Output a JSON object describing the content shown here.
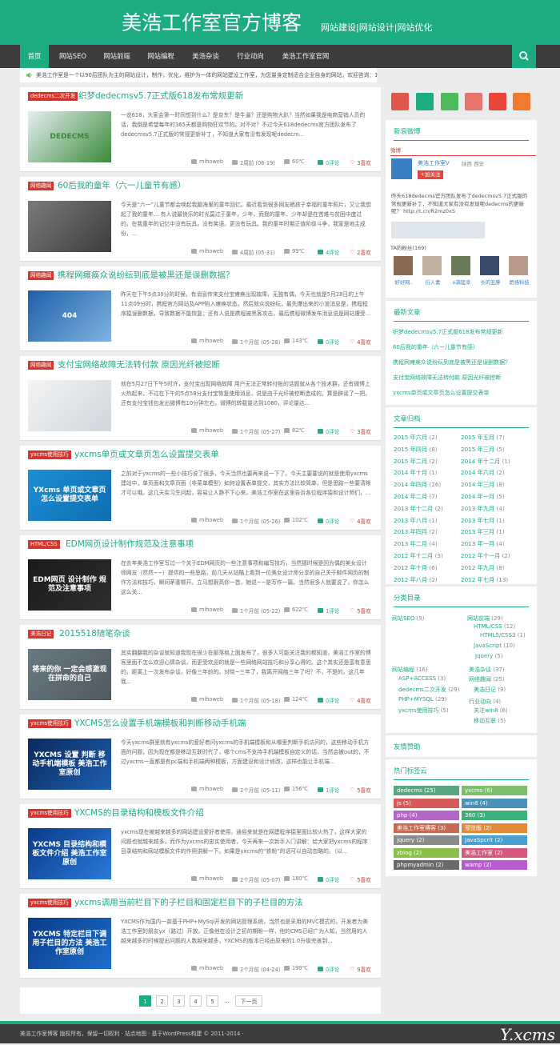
{
  "header": {
    "title": "美浩工作室官方博客",
    "subtitle": "网站建设|网站设计|网站优化"
  },
  "nav": {
    "items": [
      "首页",
      "网站SEO",
      "网站前端",
      "网站编程",
      "美浩杂谈",
      "行业动向",
      "美浩工作室官网"
    ],
    "active": 0
  },
  "notice": "美浩工作室是一个以90后团队为主的网站设计，制作，优化，维护为一体的网站建设工作室，为您量身定制适合企业自身的网站，欢迎咨询：15249241469",
  "posts": [
    {
      "category": "dedecms二次开发",
      "title": "织梦dedecmsv5.7正式版618发布常规更新",
      "excerpt": "一说618，大家会第一时间想到什么？是京东？是牛逼？还是购物大趴？当然如果我是电商营销人员的话，我倒是希望每年的365天都是购物狂欢节的。对不对？不过今天618dedecms官方团队发布了dedecmsv5.7正式版的常规更新补丁，不知道大家有没有发现呢dedecm...",
      "author": "mihoweb",
      "time": "2周前 (06-19)",
      "views": "60℃",
      "comments": "0评论",
      "likes": "3喜欢",
      "thumb_text": "DEDECMS"
    },
    {
      "category": "网络趣闻",
      "title": "60后我的童年（六一儿童节有感）",
      "excerpt": "今天是“六一”儿童节都会唤起我脑海里的童年回忆。最近看到很多网友晒孩子幸福的童年照片，又让我想起了我的童年… 有人说最快乐的时光莫过于童年，少年，而我的童年、少年却是在苦难与贫困中度过的。在我童年的记忆中没有玩具，没有笑语。更没有玩具。我的童年时期正值阶级斗争，我家是地主成份，...",
      "author": "mihoweb",
      "time": "4周前 (05-31)",
      "views": "99℃",
      "comments": "4评论",
      "likes": "2喜欢",
      "thumb_text": ""
    },
    {
      "category": "网络趣闻",
      "title": "携程网瘫痪众说纷纭到底是被黑还是误删数据？",
      "excerpt": "昨天在下午5点30分的时候，有消息传来支付宝瘫痪出现故障，无独有偶，今天也就是5月28日的上午11点09分时，携程官方网站及APP陷入瘫痪状态。然后就众说纷纭，最先爆出来的小道消息是，携程程序猿误删数据，导致数据不能恢复；还有人说是携程被黑客攻击，最后携程微博发布消息说是网站遭受...",
      "author": "mihoweb",
      "time": "1个月前 (05-28)",
      "views": "143℃",
      "comments": "0评论",
      "likes": "4喜欢",
      "thumb_text": "404"
    },
    {
      "category": "网络趣闻",
      "title": "支付宝网络故障无法转付款 原因光纤被挖断",
      "excerpt": "就在5月27日下午5时许，支付宝出现网络故障 用户无法正常转付账的话题就从各个技术群，还有微博上火热起来，不过在下午的5点58分支付宝恢复使用消息，说是由于光纤被挖断造成的。算是辟谣了一把。 还有支付宝钱包发出微博有10分钟左右，微博的转载量达到1080，评论量达...",
      "author": "mihoweb",
      "time": "1个月前 (05-27)",
      "views": "82℃",
      "comments": "0评论",
      "likes": "3喜欢",
      "thumb_text": ""
    },
    {
      "category": "yxcms使用技巧",
      "title": "yxcms单页或文章页怎么设置提交表单",
      "excerpt": "之前对于yxcms的一些小技巧说了很多，今天当然也要再来说一下了。今天主要要说的就是使用yxcms建站中，单页面和文章页面（非菜单模型）如何设置表单提交，其实方法比较简单，但是思路一些要清晰才可以哦。这几天实习生问起，容易让人静不下心来。美浩工作室在这里告诉各位程序猿和设计师们，...",
      "author": "mihoweb",
      "time": "1个月前 (05-26)",
      "views": "102℃",
      "comments": "0评论",
      "likes": "4喜欢",
      "thumb_text": "YXcms 单页或文章页 怎么设置提交表单"
    },
    {
      "category": "HTML/CSS",
      "title": "EDM网页设计制作规范及注意事项",
      "excerpt": "在去年美浩工作室写过一个关于EDM网页的一些注意事项和编写技巧，当然那时候是因为偶的美女设计师网友（然然~~）提供的一些思路，前几天从站酷上看到一位美女设计师分享的自己关于邮件网页的制作方法和技巧，瞬间茅塞顿开。立马想跟高你一首，她说~~是写作一篇。当然很多人就要说了，你怎么这么关...",
      "author": "mihoweb",
      "time": "1个月前 (05-22)",
      "views": "622℃",
      "comments": "1评论",
      "likes": "5喜欢",
      "thumb_text": "EDM网页 设计制作 规范及注意事项"
    },
    {
      "category": "美浩日记",
      "title": "2015518随笔杂谈",
      "excerpt": "其实翻翻我的杂谈就知道我现在很少在部落格上面发布了，很多人可能关注我的都知道，美浩工作室的博客里面不怎么欢迎心情杂谈，而更受欢迎的就是一些网络网站技巧和分享心得的。这个其实还是蛮有意思的。距离上一次发布杂谈，好像三年前的。对晓~三年了，我离开网络三年了吗？不，不是的。这几年我...",
      "author": "mihoweb",
      "time": "1个月前 (05-18)",
      "views": "124℃",
      "comments": "0评论",
      "likes": "4喜欢",
      "thumb_text": "将来的你 一定会感激现在拼命的自己"
    },
    {
      "category": "yxcms使用技巧",
      "title": "YXCMS怎么设置手机端模板和判断移动手机端",
      "excerpt": "今天yxcms群里就有yxcms的爱好者问yxcms的手机端模板和从哪里判断手机访问的，这些移动手机方面的问题，因为现在都是移动互联时代了，哪个cms不支持手机端模板自定义的话，当然会被out的，不过yxcms一直都是有pc端和手机端两种模板，方面建设和设计修改，这样也能让手机端...",
      "author": "mihoweb",
      "time": "2个月前 (05-11)",
      "views": "156℃",
      "comments": "1评论",
      "likes": "5喜欢",
      "thumb_text": "YXCMS 设置 判断 移动手机端模板 美浩工作室原创"
    },
    {
      "category": "yxcms使用技巧",
      "title": "YXCMS的目录结构和模板文件介绍",
      "excerpt": "yxcms现在被越来越多的网站建设爱好者使用，通俗来就是在网建程序猿里面比较火热了，这样大家的问题也就越来越多，而作为yxcms的忠实使用者，今天再来一次新手入门讲解：给大家把yxcms的程序目录结构和网站模板文件的作用讲解一下。如果是yxcms的“铁粉”的话可以自动忽略的。（以...",
      "author": "mihoweb",
      "time": "2个月前 (05-07)",
      "views": "180℃",
      "comments": "0评论",
      "likes": "5喜欢",
      "thumb_text": "YXCMS 目录结构和模板文件介绍 美浩工作室原创"
    },
    {
      "category": "yxcms使用技巧",
      "title": "yxcms调用当前栏目下的子栏目和固定栏目下的子栏目的方法",
      "excerpt": "YXCMS作为国内一款基于PHP+MySql开发的网站管理系统，当然也是采用的MVC模式的，开发者为美浩工作室的朋友yx（路过）开放，正像他在设计之初的期盼一样，他的CMS已经广为人知，当然用的人越来越多的时候提出问题的人数越来越多，YXCMS的版本已经由原来的1.0升级完善到...",
      "author": "mihoweb",
      "time": "2个月前 (04-24)",
      "views": "199℃",
      "comments": "0评论",
      "likes": "9喜欢",
      "thumb_text": "YXCMS 特定栏目下调用子栏目的方法 美浩工作室原创"
    }
  ],
  "pager": {
    "pages": [
      "1",
      "2",
      "3",
      "4",
      "5"
    ],
    "ellipsis": "...",
    "next": "下一页"
  },
  "footer": "美浩工作室博客 版权所有，保留一切权利 · 站点地图 · 基于WordPress构建 © 2011-2014 ·",
  "footer_logo": "Y.xcms",
  "sidebar": {
    "weibo": {
      "title": "新浪微博",
      "label": "微博",
      "name": "美浩工作室V",
      "location": "陕西 西安",
      "follow": "+加关注",
      "text": "昨天618dedecms官方团队发布了dedecmsv5.7正式版的常规更新补丁，不知道大家有没有发现呢dedecms的更新呢？ http://t.cn/R2mz0xS",
      "fans_label": "TA的粉丝(169)",
      "fans": [
        "好好网..",
        "衍人素",
        "o满猛幸",
        "长的丑胖",
        "昂扬科技"
      ]
    },
    "recent": {
      "title": "最新文章",
      "items": [
        "织梦dedecmsv5.7正式版618发布常规更新",
        "60后我的童年（六一儿童节有感）",
        "携程网瘫痪众说纷纭到底是被黑还是误删数据？",
        "支付宝网络故障无法转付款 原因光纤被挖断",
        "yxcms单页或文章页怎么设置提交表单"
      ]
    },
    "archive": {
      "title": "文章归档",
      "items": [
        [
          "2015 年六月",
          "(2)"
        ],
        [
          "2015 年五月",
          "(7)"
        ],
        [
          "2015 年四月",
          "(8)"
        ],
        [
          "2015 年三月",
          "(5)"
        ],
        [
          "2015 年二月",
          "(2)"
        ],
        [
          "2014 年十二月",
          "(1)"
        ],
        [
          "2014 年十月",
          "(1)"
        ],
        [
          "2014 年六月",
          "(2)"
        ],
        [
          "2014 年四月",
          "(26)"
        ],
        [
          "2014 年三月",
          "(8)"
        ],
        [
          "2014 年二月",
          "(7)"
        ],
        [
          "2014 年一月",
          "(5)"
        ],
        [
          "2013 年十二月",
          "(2)"
        ],
        [
          "2013 年九月",
          "(4)"
        ],
        [
          "2013 年八月",
          "(1)"
        ],
        [
          "2013 年七月",
          "(1)"
        ],
        [
          "2013 年四月",
          "(2)"
        ],
        [
          "2013 年三月",
          "(1)"
        ],
        [
          "2013 年二月",
          "(4)"
        ],
        [
          "2013 年一月",
          "(4)"
        ],
        [
          "2012 年十二月",
          "(3)"
        ],
        [
          "2012 年十一月",
          "(2)"
        ],
        [
          "2012 年十月",
          "(6)"
        ],
        [
          "2012 年九月",
          "(8)"
        ],
        [
          "2012 年八月",
          "(2)"
        ],
        [
          "2012 年七月",
          "(13)"
        ],
        [
          "2012 年六月",
          "(34)"
        ]
      ]
    },
    "categories": {
      "title": "分类目录",
      "items": [
        [
          "网站SEO",
          "(9)"
        ],
        [
          "网站前端",
          "(29)"
        ],
        [
          "HTML/CSS",
          "(12)"
        ],
        [
          "HTML5/CSS3",
          "(1)"
        ],
        [
          "JavaScript",
          "(10)"
        ],
        [
          "Jquery",
          "(5)"
        ],
        [
          "网站编程",
          "(16)"
        ],
        [
          "美浩杂谈",
          "(37)"
        ],
        [
          "ASP+ACCESS",
          "(3)"
        ],
        [
          "网络趣闻",
          "(25)"
        ],
        [
          "dedecms二次开发",
          "(29)"
        ],
        [
          "美浩日记",
          "(9)"
        ],
        [
          "PHP+MYSQL",
          "(29)"
        ],
        [
          "yxcms使用技巧",
          "(5)"
        ],
        [
          "行业动向",
          "(4)"
        ],
        [
          "关注win8",
          "(6)"
        ],
        [
          "移动互联",
          "(5)"
        ]
      ]
    },
    "links_title": "友情赞助",
    "tags": {
      "title": "热门标签云",
      "items": [
        [
          "dedecms",
          "(25)",
          "#5aa77d"
        ],
        [
          "yxcms",
          "(6)",
          "#7bbf6a"
        ],
        [
          "js",
          "(5)",
          "#d65a5a"
        ],
        [
          "win8",
          "(4)",
          "#4a90b8"
        ],
        [
          "php",
          "(4)",
          "#b266c8"
        ],
        [
          "360",
          "(3)",
          "#3bb07a"
        ],
        [
          "美浩工作室博客",
          "(3)",
          "#c46a50"
        ],
        [
          "预览版",
          "(2)",
          "#e08a3a"
        ],
        [
          "jquery",
          "(2)",
          "#8a8a8a"
        ],
        [
          "JavaSpcrit",
          "(2)",
          "#4a9fcf"
        ],
        [
          "zblog",
          "(2)",
          "#8ac04a"
        ],
        [
          "美浩工作室",
          "(2)",
          "#d6587a"
        ],
        [
          "phpmyadmin",
          "(2)",
          "#6a6a6a"
        ],
        [
          "wamp",
          "(2)",
          "#b85ad0"
        ]
      ]
    }
  },
  "colors": {
    "accent": "#1dab82",
    "nav_bg": "#3d3d3d",
    "category_badge": "#d9332a",
    "like": "#d9332a"
  }
}
